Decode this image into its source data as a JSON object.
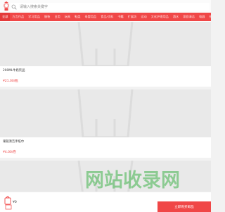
{
  "search": {
    "placeholder": "请输入搜索关键字"
  },
  "categories": [
    {
      "label": "全部",
      "active": true
    },
    {
      "label": "方言作品"
    },
    {
      "label": "学习用品"
    },
    {
      "label": "服装"
    },
    {
      "label": "日用"
    },
    {
      "label": "玩具"
    },
    {
      "label": "鞋类"
    },
    {
      "label": "母婴用品"
    },
    {
      "label": "食品·饮料"
    },
    {
      "label": "书籍"
    },
    {
      "label": "扩展坊"
    },
    {
      "label": "运动"
    },
    {
      "label": "文化护理用品"
    },
    {
      "label": "酒水"
    },
    {
      "label": "家庭清洁"
    },
    {
      "label": "电器"
    },
    {
      "label": "茶叶"
    },
    {
      "label": "生鲜"
    },
    {
      "label": "其他"
    }
  ],
  "products": [
    {
      "name": "200ML牛奶饮品",
      "price": "¥21.00/瓶"
    },
    {
      "name": "果蔬清洁手纸巾",
      "price": "¥4.00/卷"
    },
    {
      "name": "",
      "price": ""
    }
  ],
  "bottom_bar": {
    "qty": "¥0",
    "buy_label": "立即购买邮品"
  },
  "watermark": {
    "text": "网站收录网"
  },
  "colors": {
    "accent": "#f04747",
    "price": "#e44444",
    "placeholder": "#e9e9e9"
  },
  "icons": [
    "logo-icon",
    "search-icon",
    "bag-icon",
    "placeholder-bag-icon"
  ]
}
